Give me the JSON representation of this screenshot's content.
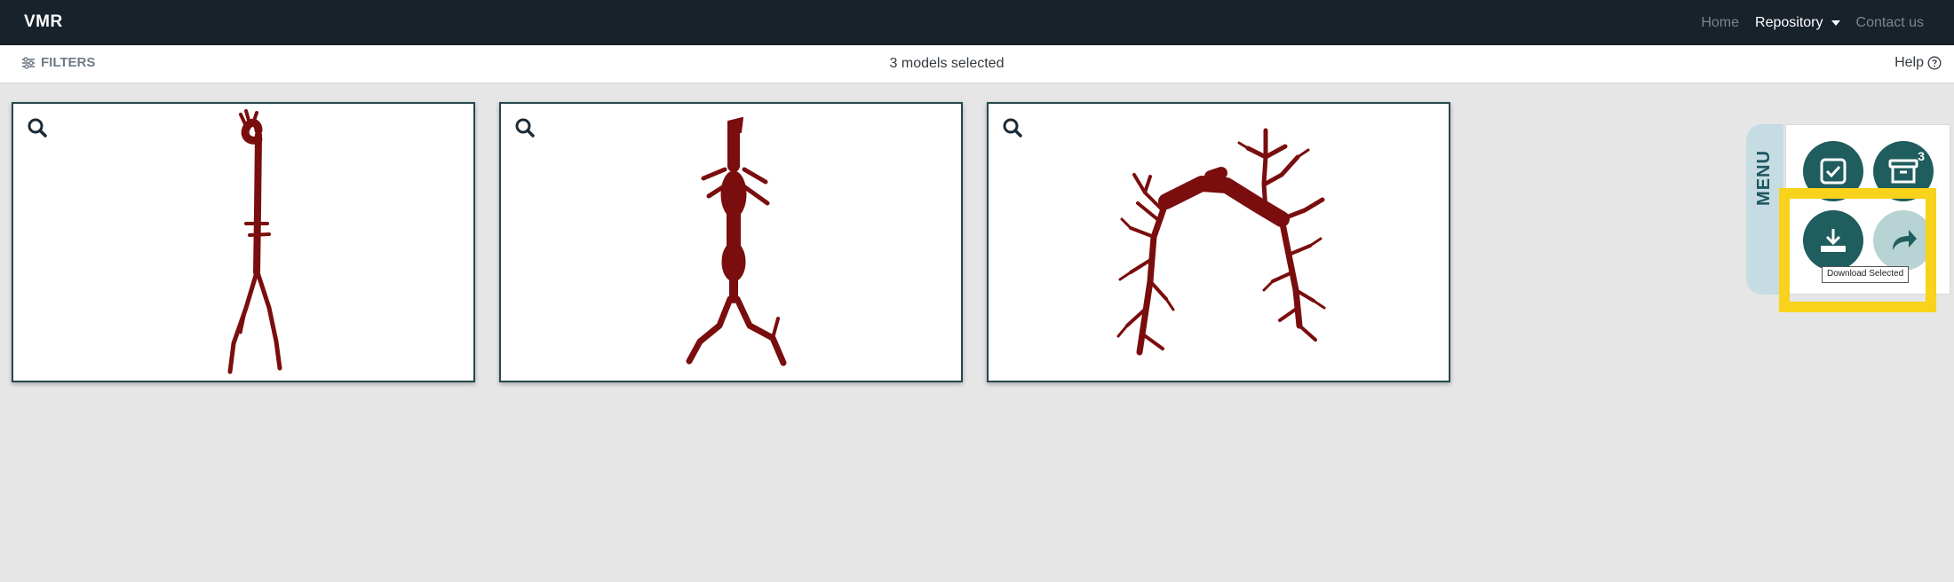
{
  "navbar": {
    "brand": "VMR",
    "links": {
      "home": "Home",
      "repository": "Repository",
      "contact": "Contact us"
    }
  },
  "toolbar": {
    "filters_label": "FILTERS",
    "selected_count": "3 models selected",
    "help_label": "Help"
  },
  "models": [
    {
      "name": "aorta-iliac-model",
      "color": "#7a0d0d"
    },
    {
      "name": "aortic-aneurysm-model",
      "color": "#7a0d0d"
    },
    {
      "name": "pulmonary-tree-model",
      "color": "#7a0d0d"
    }
  ],
  "side_menu": {
    "label": "MENU",
    "buttons": [
      {
        "icon": "checkbox-icon",
        "name": "select-all"
      },
      {
        "icon": "archive-box-icon",
        "name": "selected-models",
        "badge": "3"
      },
      {
        "icon": "download-icon",
        "name": "download-selected"
      },
      {
        "icon": "share-icon",
        "name": "share"
      }
    ],
    "tooltip": "Download Selected"
  },
  "colors": {
    "navbar_bg": "#18222b",
    "accent_teal": "#1f5d5e",
    "highlight": "#f8d21b",
    "vessel_red": "#7a0d0d"
  }
}
